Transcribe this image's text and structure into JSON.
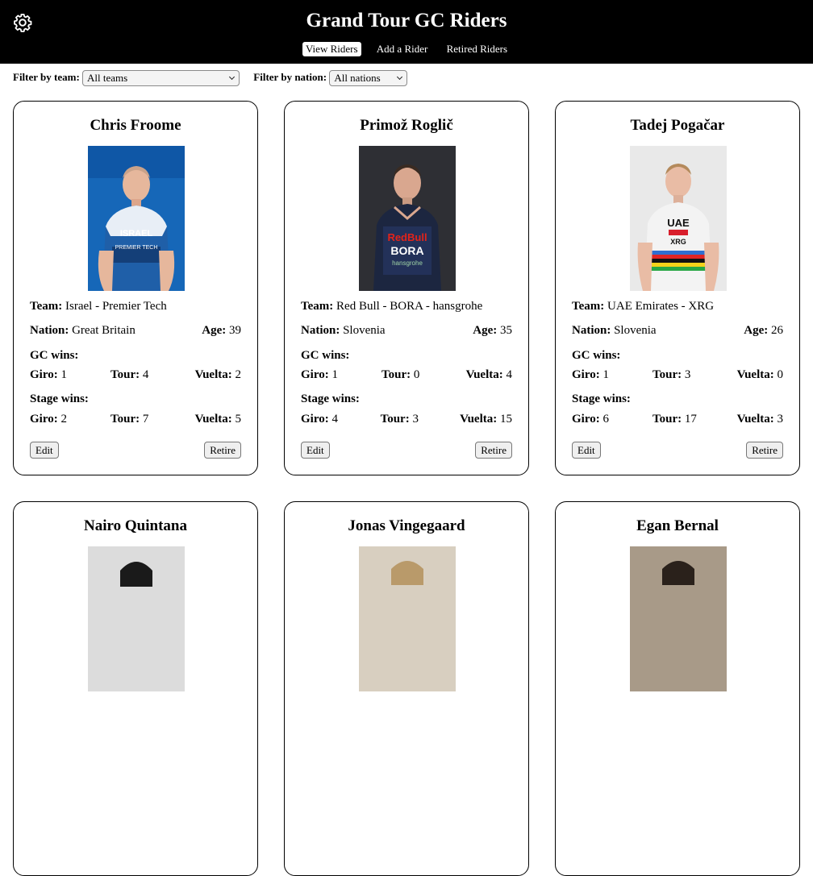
{
  "header": {
    "title": "Grand Tour GC Riders",
    "nav": [
      "View Riders",
      "Add a Rider",
      "Retired Riders"
    ],
    "active_nav": "View Riders"
  },
  "filters": {
    "team_label": "Filter by team:",
    "team_value": "All teams",
    "nation_label": "Filter by nation:",
    "nation_value": "All nations"
  },
  "labels": {
    "team": "Team:",
    "nation": "Nation:",
    "age": "Age:",
    "gc_wins": "GC wins:",
    "stage_wins": "Stage wins:",
    "giro": "Giro:",
    "tour": "Tour:",
    "vuelta": "Vuelta:",
    "edit": "Edit",
    "retire": "Retire"
  },
  "riders": [
    {
      "name": "Chris Froome",
      "team": "Israel - Premier Tech",
      "nation": "Great Britain",
      "age": "39",
      "gc": {
        "giro": "1",
        "tour": "4",
        "vuelta": "2"
      },
      "stages": {
        "giro": "2",
        "tour": "7",
        "vuelta": "5"
      },
      "jersey_color": "#1f5fa8",
      "jersey_text": "ISRAEL",
      "bg": "#1667b8"
    },
    {
      "name": "Primož Roglič",
      "team": "Red Bull - BORA - hansgrohe",
      "nation": "Slovenia",
      "age": "35",
      "gc": {
        "giro": "1",
        "tour": "0",
        "vuelta": "4"
      },
      "stages": {
        "giro": "4",
        "tour": "3",
        "vuelta": "15"
      },
      "jersey_color": "#1c2640",
      "jersey_text": "BORA",
      "bg": "#2e2f34"
    },
    {
      "name": "Tadej Pogačar",
      "team": "UAE Emirates - XRG",
      "nation": "Slovenia",
      "age": "26",
      "gc": {
        "giro": "1",
        "tour": "3",
        "vuelta": "0"
      },
      "stages": {
        "giro": "6",
        "tour": "17",
        "vuelta": "3"
      },
      "jersey_color": "#f3f3f3",
      "jersey_text": "UAE",
      "bg": "#e9e9e9"
    },
    {
      "name": "Nairo Quintana",
      "bg": "#dcdcdc"
    },
    {
      "name": "Jonas Vingegaard",
      "bg": "#d8cfc0"
    },
    {
      "name": "Egan Bernal",
      "bg": "#a89a88"
    }
  ]
}
